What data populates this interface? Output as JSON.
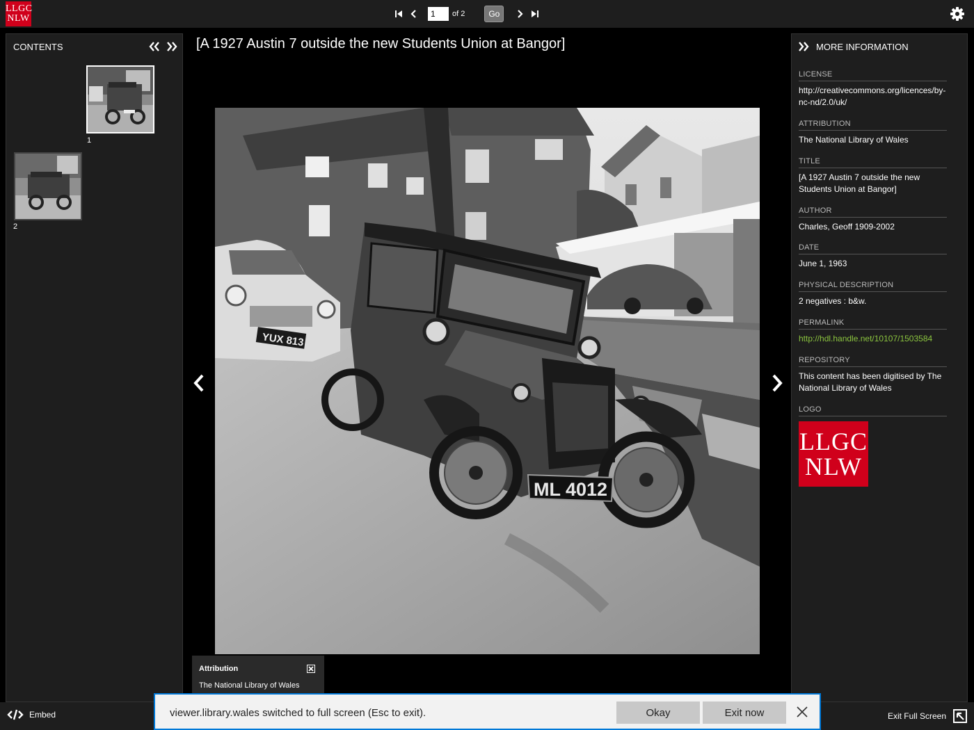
{
  "header": {
    "logo_line1": "LLGC",
    "logo_line2": "NLW",
    "page_value": "1",
    "page_total_label": "of 2",
    "go_label": "Go"
  },
  "contents": {
    "title": "CONTENTS",
    "thumbnails": [
      {
        "label": "1",
        "selected": true
      },
      {
        "label": "2",
        "selected": false
      }
    ]
  },
  "main": {
    "title": "[A 1927 Austin 7 outside the new Students Union at Bangor]",
    "plate_main": "ML 4012",
    "plate_side": "YUX 813"
  },
  "attribution_box": {
    "title": "Attribution",
    "text": "The National Library of Wales"
  },
  "more_info": {
    "title": "MORE INFORMATION",
    "fields": {
      "license": {
        "label": "LICENSE",
        "value": "http://creativecommons.org/licences/by-nc-nd/2.0/uk/"
      },
      "attribution": {
        "label": "ATTRIBUTION",
        "value": "The National Library of Wales"
      },
      "title": {
        "label": "TITLE",
        "value": "[A 1927 Austin 7 outside the new Students Union at Bangor]"
      },
      "author": {
        "label": "AUTHOR",
        "value": "Charles, Geoff 1909-2002"
      },
      "date": {
        "label": "DATE",
        "value": "June 1, 1963"
      },
      "physical": {
        "label": "PHYSICAL DESCRIPTION",
        "value": "2 negatives : b&w."
      },
      "permalink": {
        "label": "PERMALINK",
        "value": "http://hdl.handle.net/10107/1503584"
      },
      "repository": {
        "label": "REPOSITORY",
        "value": "This content has been digitised by The National Library of Wales"
      },
      "logo": {
        "label": "LOGO"
      }
    },
    "logo_line1": "LLGC",
    "logo_line2": "NLW"
  },
  "footer": {
    "embed_label": "Embed",
    "exit_label": "Exit Full Screen"
  },
  "toast": {
    "message": "viewer.library.wales switched to full screen (Esc to exit).",
    "okay_label": "Okay",
    "exit_now_label": "Exit now"
  },
  "colors": {
    "brand_red": "#d0001b",
    "link_green": "#8cc63f",
    "panel_bg": "#1e1e1e",
    "toast_border": "#0078d7"
  }
}
